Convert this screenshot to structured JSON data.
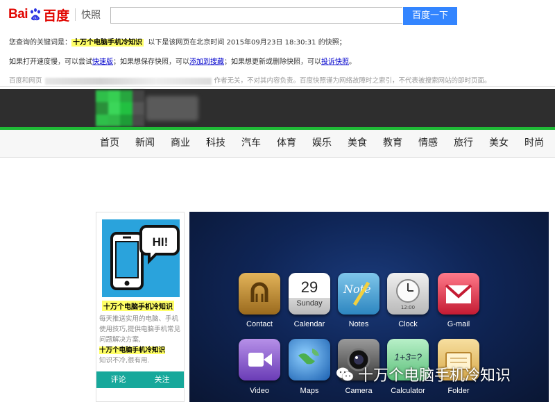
{
  "header": {
    "logo_bai": "Bai",
    "logo_du": "百度",
    "logo_kuaizhao": "快照",
    "search_value": "",
    "search_button": "百度一下"
  },
  "info": {
    "line1_prefix": "您查询的关键词是：",
    "keyword": "十万个电脑手机冷知识",
    "line1_suffix": "以下是该网页在北京时间 2015年09月23日 18:30:31 的快照；",
    "line2_a": "如果打开速度慢，可以尝试",
    "line2_link1": "快速版",
    "line2_b": "；如果想保存快照，可以",
    "line2_link2": "添加到搜藏",
    "line2_c": "；如果想更新或删除快照，可以",
    "line2_link3": "投诉快照",
    "line2_d": "。",
    "disclaimer_a": "百度和网页",
    "disclaimer_b": "作者无关，不对其内容负责。百度快照谨为网络故障时之索引，不代表被搜索网站的即时页面。"
  },
  "nav": {
    "items": [
      "首页",
      "新闻",
      "商业",
      "科技",
      "汽车",
      "体育",
      "娱乐",
      "美食",
      "教育",
      "情感",
      "旅行",
      "美女",
      "时尚"
    ]
  },
  "card": {
    "bubble_text": "HI!",
    "title": "十万个电脑手机冷知识",
    "desc_1": "每天推送实用的电脑、手机使用技巧,提供电脑手机常见问题解决方案,",
    "desc_highlight": "十万个电脑手机冷知识",
    "desc_2": "知识不冷,很有用.",
    "btn_comment": "评论",
    "btn_follow": "关注"
  },
  "apps": {
    "row1": [
      "Contact",
      "Calendar",
      "Notes",
      "Clock",
      "G-mail"
    ],
    "row2": [
      "Video",
      "Maps",
      "Camera",
      "Calculator",
      "Folder"
    ],
    "calendar_day": "29",
    "calendar_weekday": "Sunday",
    "notes_text": "Note",
    "clock_text": "12:00",
    "calculator_text": "1+3=?"
  },
  "watermark": "十万个电脑手机冷知识",
  "colors": {
    "baidu_red": "#e10601",
    "baidu_blue": "#3385ff",
    "highlight": "#ffff66",
    "nav_green": "#1fbb36",
    "card_teal": "#17a89b"
  }
}
